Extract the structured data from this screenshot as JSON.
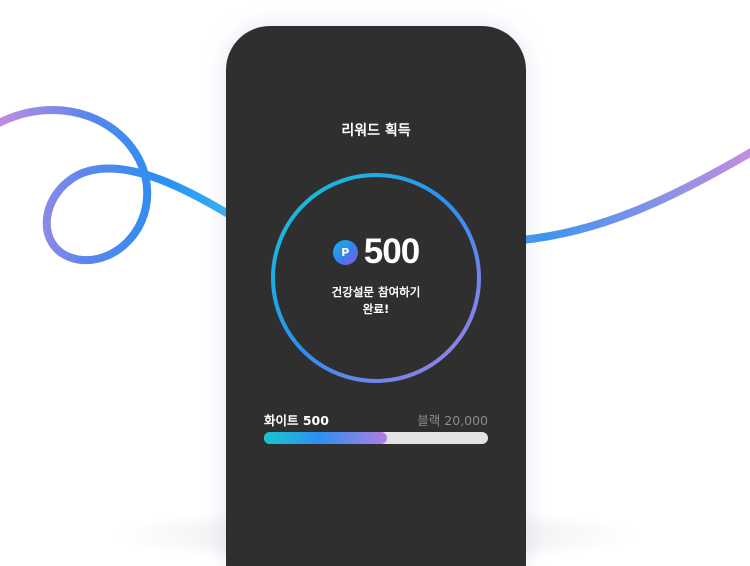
{
  "reward": {
    "title": "리워드 획득",
    "point_icon": "P",
    "points": "500",
    "message_line1": "건강설문 참여하기",
    "message_line2": "완료!"
  },
  "level": {
    "current_label": "화이트 500",
    "next_label": "블랙 20,000",
    "progress_fraction": 0.55
  },
  "colors": {
    "phone_bg": "#2f2f2f",
    "accent_teal": "#17c6cf",
    "accent_blue": "#2f8ff2",
    "accent_purple": "#b07ee2"
  }
}
